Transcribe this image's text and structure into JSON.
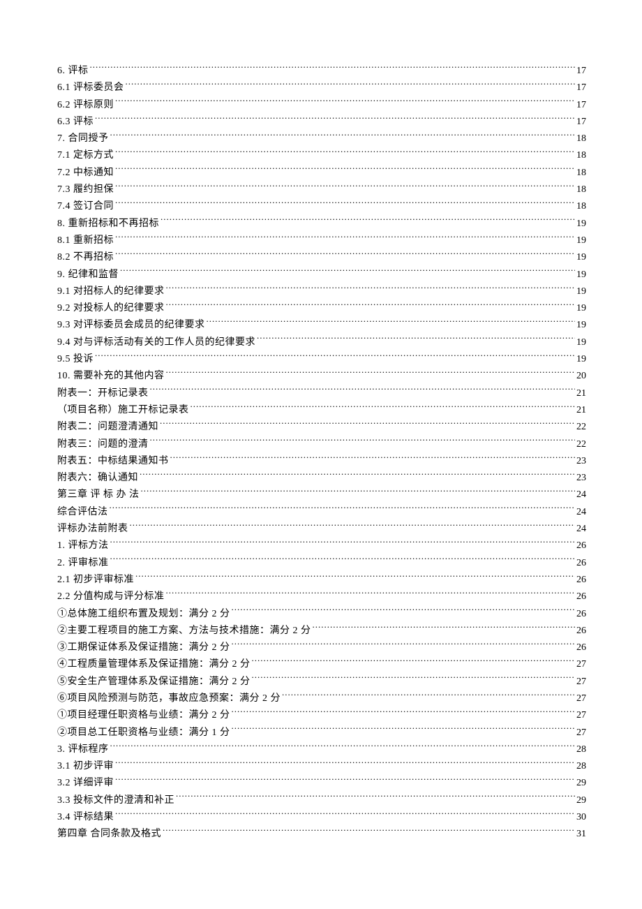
{
  "toc": [
    {
      "title": "6.  评标 ",
      "page": "17"
    },
    {
      "title": "6.1  评标委员会 ",
      "page": "17"
    },
    {
      "title": "6.2  评标原则 ",
      "page": "17"
    },
    {
      "title": "6.3  评标 ",
      "page": "17"
    },
    {
      "title": "7.  合同授予 ",
      "page": "18"
    },
    {
      "title": "7.1  定标方式 ",
      "page": "18"
    },
    {
      "title": "7.2  中标通知 ",
      "page": "18"
    },
    {
      "title": "7.3  履约担保 ",
      "page": "18"
    },
    {
      "title": "7.4  签订合同 ",
      "page": "18"
    },
    {
      "title": "8.  重新招标和不再招标 ",
      "page": "19"
    },
    {
      "title": "8.1  重新招标 ",
      "page": "19"
    },
    {
      "title": "8.2  不再招标 ",
      "page": "19"
    },
    {
      "title": "9.  纪律和监督 ",
      "page": "19"
    },
    {
      "title": "9.1  对招标人的纪律要求 ",
      "page": "19"
    },
    {
      "title": "9.2  对投标人的纪律要求 ",
      "page": "19"
    },
    {
      "title": "9.3  对评标委员会成员的纪律要求 ",
      "page": "19"
    },
    {
      "title": "9.4  对与评标活动有关的工作人员的纪律要求 ",
      "page": "19"
    },
    {
      "title": "9.5  投诉 ",
      "page": "19"
    },
    {
      "title": "10.  需要补充的其他内容 ",
      "page": "20"
    },
    {
      "title": "附表一：开标记录表 ",
      "page": "21"
    },
    {
      "title": "（项目名称）施工开标记录表 ",
      "page": "21"
    },
    {
      "title": "附表二：问题澄清通知 ",
      "page": "22"
    },
    {
      "title": "附表三：问题的澄清 ",
      "page": "22"
    },
    {
      "title": "附表五：中标结果通知书 ",
      "page": "23"
    },
    {
      "title": "附表六：确认通知 ",
      "page": "23"
    },
    {
      "title": "第三章   评 标 办 法 ",
      "page": "24"
    },
    {
      "title": "综合评估法 ",
      "page": "24"
    },
    {
      "title": "评标办法前附表 ",
      "page": "24"
    },
    {
      "title": "1.  评标方法 ",
      "page": "26"
    },
    {
      "title": "2.  评审标准 ",
      "page": "26"
    },
    {
      "title": "2.1  初步评审标准 ",
      "page": "26"
    },
    {
      "title": "2.2  分值构成与评分标准 ",
      "page": "26"
    },
    {
      "title": "①总体施工组织布置及规划：满分 2 分 ",
      "page": "26"
    },
    {
      "title": "②主要工程项目的施工方案、方法与技术措施：满分 2 分 ",
      "page": "26"
    },
    {
      "title": "③工期保证体系及保证措施：满分 2 分 ",
      "page": "26"
    },
    {
      "title": "④工程质量管理体系及保证措施：满分 2 分 ",
      "page": "27"
    },
    {
      "title": "⑤安全生产管理体系及保证措施：满分 2 分 ",
      "page": "27"
    },
    {
      "title": "⑥项目风险预测与防范，事故应急预案：满分 2 分 ",
      "page": "27"
    },
    {
      "title": "①项目经理任职资格与业绩：满分 2 分 ",
      "page": "27"
    },
    {
      "title": "②项目总工任职资格与业绩：满分 1 分 ",
      "page": "27"
    },
    {
      "title": "3.  评标程序 ",
      "page": "28"
    },
    {
      "title": "3.1  初步评审 ",
      "page": "28"
    },
    {
      "title": "3.2  详细评审 ",
      "page": "29"
    },
    {
      "title": "3.3  投标文件的澄清和补正 ",
      "page": "29"
    },
    {
      "title": "3.4 评标结果 ",
      "page": "30"
    },
    {
      "title": "第四章   合同条款及格式 ",
      "page": "31"
    }
  ]
}
